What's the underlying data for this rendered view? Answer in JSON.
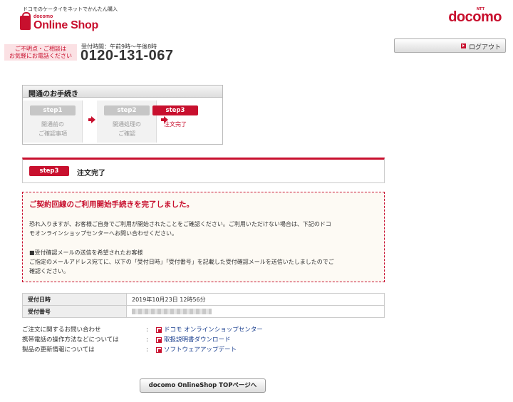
{
  "header": {
    "tagline": "ドコモのケータイをネットでかんたん購入",
    "logo_small": "docomo",
    "logo_big": "Online Shop",
    "brand_ntt": "NTT",
    "brand_name": "docomo",
    "contact_line1": "ご不明点・ご相談は",
    "contact_line2": "お気軽にお電話ください",
    "hours": "受付時間：午前9時〜午後8時",
    "phone": "0120-131-067",
    "logout_label": "ログアウト"
  },
  "steps": {
    "title": "開通のお手続き",
    "items": [
      {
        "pill": "step1",
        "line1": "開通前の",
        "line2": "ご確認事項",
        "active": false
      },
      {
        "pill": "step2",
        "line1": "開通処理の",
        "line2": "ご確認",
        "active": false
      },
      {
        "pill": "step3",
        "line1": "注文完了",
        "line2": "",
        "active": true
      }
    ]
  },
  "current_step": {
    "pill": "step3",
    "title": "注文完了"
  },
  "message": {
    "heading": "ご契約回線のご利用開始手続きを完了しました。",
    "para1_line1": "恐れ入りますが、お客様ご自身でご利用が開始されたことをご確認ください。ご利用いただけない場合は、下記のドコ",
    "para1_line2": "モオンラインショップセンターへお問い合わせください。",
    "para2_line1": "■受付確認メールの送信を希望されたお客様",
    "para2_line2": "ご指定のメールアドレス宛てに、以下の「受付日時」「受付番号」を記載した受付確認メールを送信いたしましたのでご",
    "para2_line3": "確認ください。"
  },
  "order_info": {
    "date_label": "受付日時",
    "date_value": "2019年10月23日 12時56分",
    "number_label": "受付番号"
  },
  "links": [
    {
      "label": "ご注文に関するお問い合わせ",
      "colon": ":",
      "link": "ドコモ オンラインショップセンター"
    },
    {
      "label": "携帯電話の操作方法などについては",
      "colon": ":",
      "link": "取扱説明書ダウンロード"
    },
    {
      "label": "製品の更新情報については",
      "colon": ":",
      "link": "ソフトウェアアップデート"
    }
  ],
  "top_button_label": "docomo OnlineShop TOPページへ",
  "colors": {
    "accent": "#c8102e",
    "link": "#1a3f8f",
    "pink_bg": "#fbe1e4",
    "message_bg": "#fdfaf4"
  }
}
